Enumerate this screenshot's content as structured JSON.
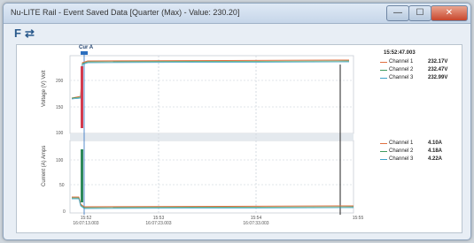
{
  "window": {
    "title": "Nu-LITE Rail - Event Saved Data [Quarter (Max) - Value: 230.20]",
    "controls": {
      "minimize": "—",
      "maximize": "☐",
      "close": "✕"
    }
  },
  "toolbar": {
    "tool1": "F",
    "tool2": "⇄"
  },
  "cursor": {
    "label": "Cur A"
  },
  "voltage_panel": {
    "ylabel": "Voltage (V)\nVolt",
    "ticks": [
      "200",
      "150",
      "100"
    ],
    "timestamp": "15:52:47.003",
    "items": [
      {
        "name": "Channel 1",
        "value": "232.17V",
        "color": "#e07040"
      },
      {
        "name": "Channel 2",
        "value": "232.47V",
        "color": "#3e9a5e"
      },
      {
        "name": "Channel 3",
        "value": "232.99V",
        "color": "#3aa0c8"
      }
    ]
  },
  "current_panel": {
    "ylabel": "Current (A)\nAmps",
    "ticks": [
      "100",
      "50",
      "0"
    ],
    "items": [
      {
        "name": "Channel 1",
        "value": "4.10A",
        "color": "#e07040"
      },
      {
        "name": "Channel 2",
        "value": "4.18A",
        "color": "#3e9a5e"
      },
      {
        "name": "Channel 3",
        "value": "4.22A",
        "color": "#3aa0c8"
      }
    ]
  },
  "xaxis": {
    "ticks": [
      {
        "t": "15:52\n16:07:13.003"
      },
      {
        "t": "15:53\n16:07:23.003"
      },
      {
        "t": "15:54\n16:07:33.003"
      },
      {
        "t": "15:55"
      }
    ]
  }
}
